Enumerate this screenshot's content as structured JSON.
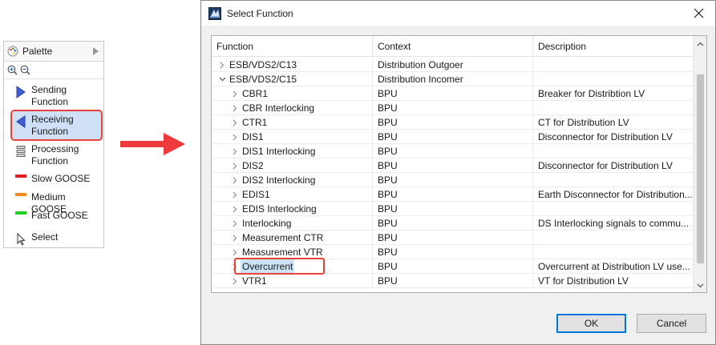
{
  "palette": {
    "title": "Palette",
    "items": [
      {
        "label_lines": [
          "Sending",
          "Function"
        ],
        "icon": "sending-triangle-icon"
      },
      {
        "label_lines": [
          "Receiving",
          "Function"
        ],
        "icon": "receiving-triangle-icon",
        "selected": true
      },
      {
        "label_lines": [
          "Processing",
          "Function"
        ],
        "icon": "processing-stack-icon"
      },
      {
        "label_lines": [
          "Slow GOOSE"
        ],
        "color": "#e02020"
      },
      {
        "label_lines": [
          "Medium GOOSE"
        ],
        "color": "#f08c1e"
      },
      {
        "label_lines": [
          "Fast GOOSE"
        ],
        "color": "#22d022"
      },
      {
        "label_lines": [
          "Select"
        ],
        "icon": "pointer-icon"
      }
    ]
  },
  "dialog": {
    "title": "Select Function",
    "columns": [
      "Function",
      "Context",
      "Description"
    ],
    "rows": [
      {
        "function": "ESB/VDS2/C13",
        "context": "Distribution Outgoer",
        "description": "",
        "level": 0,
        "expanded": false
      },
      {
        "function": "ESB/VDS2/C15",
        "context": "Distribution Incomer",
        "description": "",
        "level": 0,
        "expanded": true
      },
      {
        "function": "CBR1",
        "context": "BPU",
        "description": "Breaker for Distribtion LV",
        "level": 1,
        "expanded": false
      },
      {
        "function": "CBR Interlocking",
        "context": "BPU",
        "description": "",
        "level": 1,
        "expanded": false
      },
      {
        "function": "CTR1",
        "context": "BPU",
        "description": "CT for Distribution LV",
        "level": 1,
        "expanded": false
      },
      {
        "function": "DIS1",
        "context": "BPU",
        "description": "Disconnector for Distribution LV",
        "level": 1,
        "expanded": false
      },
      {
        "function": "DIS1 Interlocking",
        "context": "BPU",
        "description": "",
        "level": 1,
        "expanded": false
      },
      {
        "function": "DIS2",
        "context": "BPU",
        "description": "Disconnector for Distribution LV",
        "level": 1,
        "expanded": false
      },
      {
        "function": "DIS2 Interlocking",
        "context": "BPU",
        "description": "",
        "level": 1,
        "expanded": false
      },
      {
        "function": "EDIS1",
        "context": "BPU",
        "description": "Earth Disconnector for Distribution...",
        "level": 1,
        "expanded": false
      },
      {
        "function": "EDIS Interlocking",
        "context": "BPU",
        "description": "",
        "level": 1,
        "expanded": false
      },
      {
        "function": "Interlocking",
        "context": "BPU",
        "description": "DS Interlocking signals to commu...",
        "level": 1,
        "expanded": false
      },
      {
        "function": "Measurement CTR",
        "context": "BPU",
        "description": "",
        "level": 1,
        "expanded": false
      },
      {
        "function": "Measurement VTR",
        "context": "BPU",
        "description": "",
        "level": 1,
        "expanded": false
      },
      {
        "function": "Overcurrent",
        "context": "BPU",
        "description": "Overcurrent at Distribution LV use...",
        "level": 1,
        "expanded": false,
        "selected": true
      },
      {
        "function": "VTR1",
        "context": "BPU",
        "description": "VT for Distribution LV",
        "level": 1,
        "expanded": false
      }
    ],
    "ok_label": "OK",
    "cancel_label": "Cancel"
  }
}
